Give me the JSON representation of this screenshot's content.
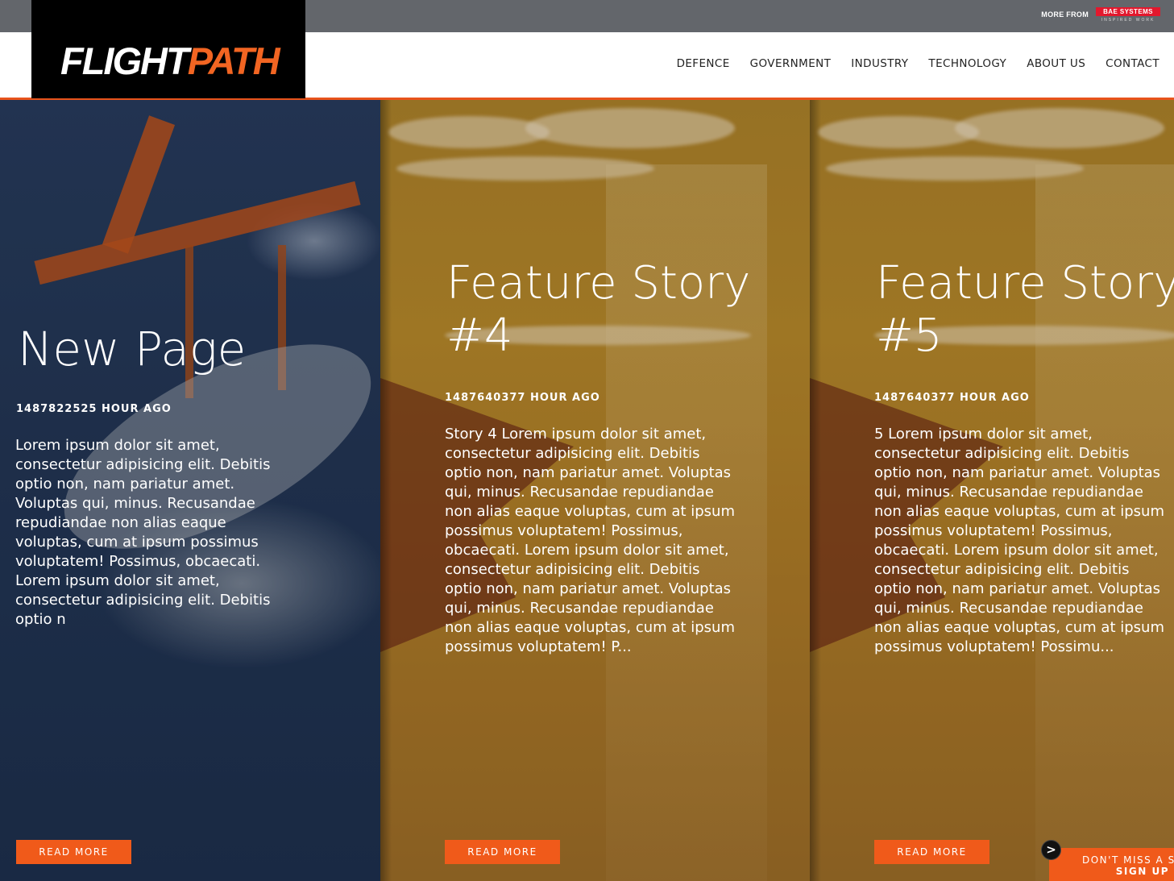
{
  "topbar": {
    "more_from": "MORE FROM",
    "brand_name": "BAE SYSTEMS",
    "brand_tagline": "INSPIRED WORK",
    "brand_color": "#e3182d"
  },
  "header": {
    "logo_part1": "FLIGHT",
    "logo_part2": "PATH",
    "accent_color": "#f26522"
  },
  "nav": {
    "items": [
      {
        "label": "DEFENCE"
      },
      {
        "label": "GOVERNMENT"
      },
      {
        "label": "INDUSTRY"
      },
      {
        "label": "TECHNOLOGY"
      },
      {
        "label": "ABOUT US"
      },
      {
        "label": "CONTACT"
      }
    ]
  },
  "panels": [
    {
      "title": "New Page",
      "time": "1487822525 HOUR AGO",
      "body": "Lorem ipsum dolor sit amet, consectetur adipisicing elit. Debitis optio non, nam pariatur amet. Voluptas qui, minus. Recusandae repudiandae non alias eaque voluptas, cum at ipsum possimus voluptatem! Possimus, obcaecati. Lorem ipsum dolor sit amet, consectetur adipisicing elit. Debitis optio n",
      "button": "READ MORE"
    },
    {
      "title": "Feature Story #4",
      "time": "1487640377 HOUR AGO",
      "body": "Story 4 Lorem ipsum dolor sit amet, consectetur adipisicing elit. Debitis optio non, nam pariatur amet. Voluptas qui, minus. Recusandae repudiandae non alias eaque voluptas, cum at ipsum possimus voluptatem! Possimus, obcaecati. Lorem ipsum dolor sit amet, consectetur adipisicing elit. Debitis optio non, nam pariatur amet. Voluptas qui, minus. Recusandae repudiandae non alias eaque voluptas, cum at ipsum possimus voluptatem! P...",
      "button": "READ MORE"
    },
    {
      "title": "Feature Story #5",
      "time": "1487640377 HOUR AGO",
      "body": "5 Lorem ipsum dolor sit amet, consectetur adipisicing elit. Debitis optio non, nam pariatur amet. Voluptas qui, minus. Recusandae repudiandae non alias eaque voluptas, cum at ipsum possimus voluptatem! Possimus, obcaecati. Lorem ipsum dolor sit amet, consectetur adipisicing elit. Debitis optio non, nam pariatur amet. Voluptas qui, minus. Recusandae repudiandae non alias eaque voluptas, cum at ipsum possimus voluptatem! Possimu...",
      "button": "READ MORE"
    }
  ],
  "signup": {
    "line1": "DON'T MISS A S",
    "line2": "SIGN UP",
    "arrow": ">",
    "icon": "arrow-right-icon"
  }
}
